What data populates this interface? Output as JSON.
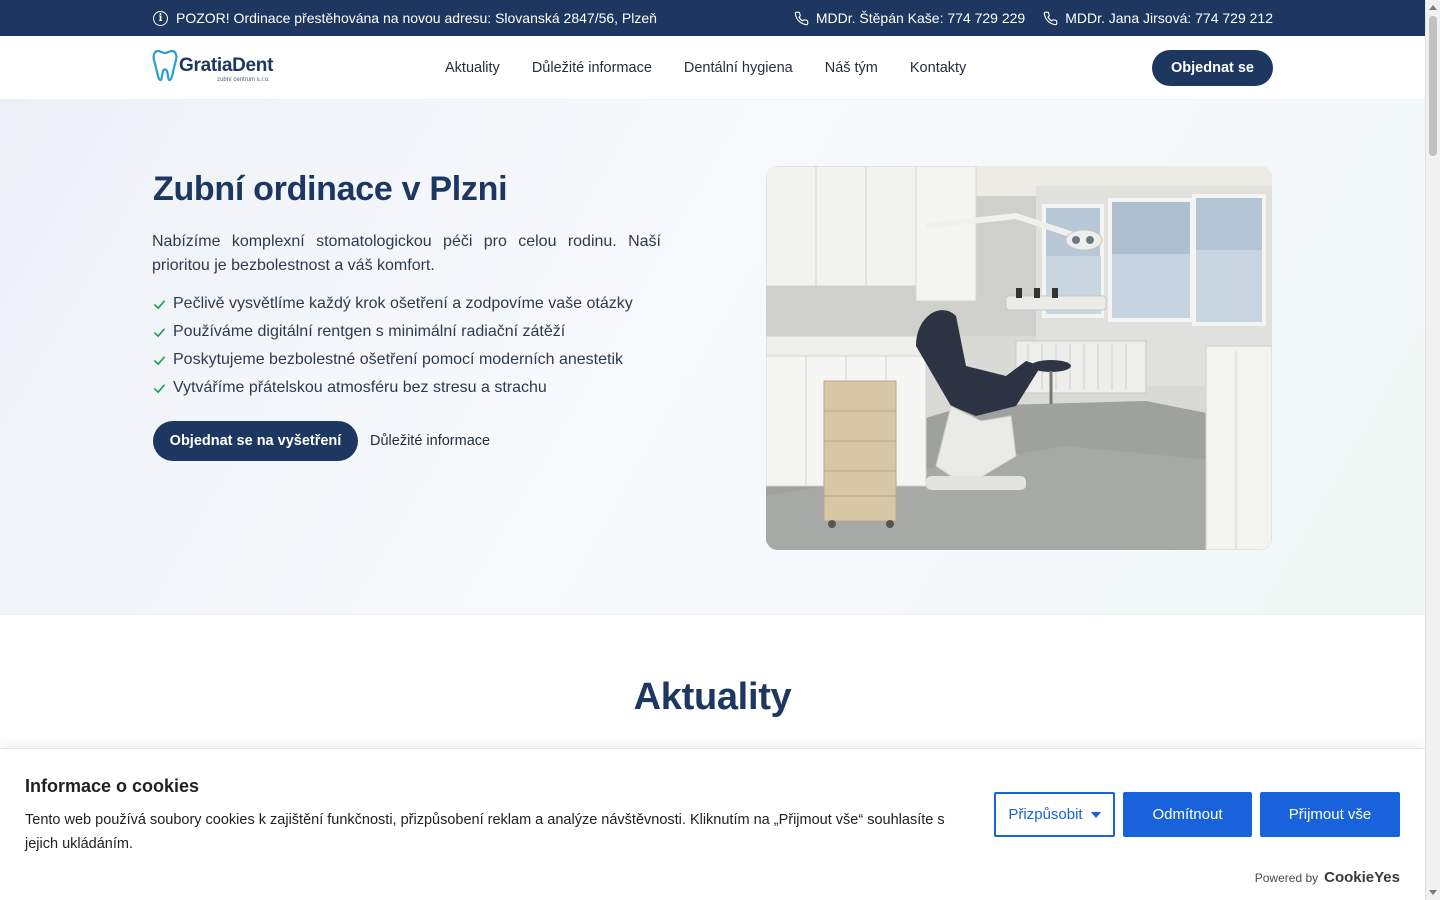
{
  "topbar": {
    "notice": "POZOR! Ordinace přestěhována na novou adresu: Slovanská 2847/56, Plzeň",
    "phones": [
      "MDDr. Štěpán Kaše: 774 729 229",
      "MDDr. Jana Jirsová: 774 729 212"
    ]
  },
  "header": {
    "logo_name": "GratiaDent",
    "logo_sub": "zubní centrum s.r.o.",
    "nav": [
      "Aktuality",
      "Důležité informace",
      "Dentální hygiena",
      "Náš tým",
      "Kontakty"
    ],
    "cta": "Objednat se"
  },
  "hero": {
    "title": "Zubní ordinace v Plzni",
    "description": "Nabízíme komplexní stomatologickou péči pro celou rodinu. Naší prioritou je bezbolestnost a váš komfort.",
    "features": [
      "Pečlivě vysvětlíme každý krok ošetření a zodpovíme vaše otázky",
      "Používáme digitální rentgen s minimální radiační zátěží",
      "Poskytujeme bezbolestné ošetření pomocí moderních anestetik",
      "Vytváříme přátelskou atmosféru bez stresu a strachu"
    ],
    "primary_button": "Objednat se na vyšetření",
    "secondary_link": "Důležité informace"
  },
  "news": {
    "title": "Aktuality"
  },
  "cookie": {
    "title": "Informace o cookies",
    "text": "Tento web používá soubory cookies k zajištění funkčnosti, přizpůsobení reklam a analýze návštěvnosti. Kliknutím na „Přijmout vše“ souhlasíte s jejich ukládáním.",
    "customize": "Přizpůsobit",
    "reject": "Odmítnout",
    "accept": "Přijmout vše",
    "powered_by": "Powered by",
    "brand": "CookieYes"
  },
  "colors": {
    "navy": "#1d3761",
    "cookie_blue": "#1863dc",
    "check_green": "#1f9e5a"
  }
}
